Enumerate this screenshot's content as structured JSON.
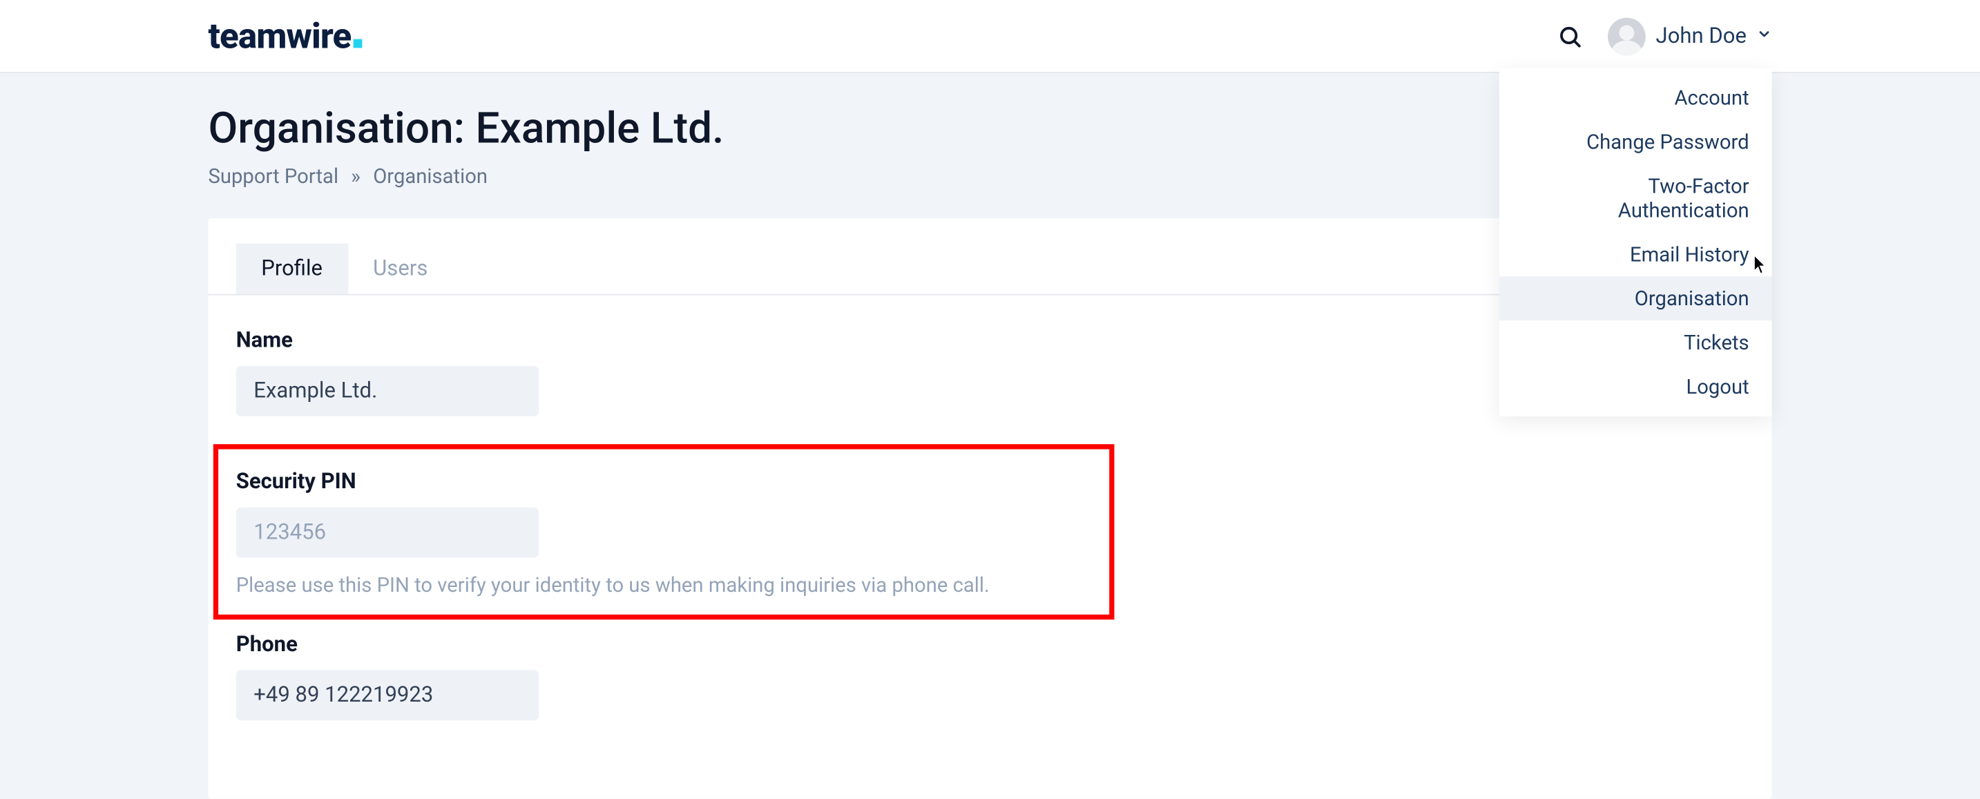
{
  "brand": {
    "name": "teamwire"
  },
  "user": {
    "display_name": "John Doe"
  },
  "dropdown": {
    "items": [
      {
        "label": "Account",
        "highlight": false
      },
      {
        "label": "Change Password",
        "highlight": false
      },
      {
        "label": "Two-Factor Authentication",
        "highlight": false
      },
      {
        "label": "Email History",
        "highlight": false
      },
      {
        "label": "Organisation",
        "highlight": true
      },
      {
        "label": "Tickets",
        "highlight": false
      },
      {
        "label": "Logout",
        "highlight": false
      }
    ]
  },
  "page": {
    "title": "Organisation: Example Ltd.",
    "breadcrumb": {
      "root": "Support Portal",
      "sep": "»",
      "current": "Organisation"
    }
  },
  "tabs": [
    {
      "label": "Profile",
      "active": true
    },
    {
      "label": "Users",
      "active": false
    }
  ],
  "profile": {
    "name": {
      "label": "Name",
      "value": "Example Ltd."
    },
    "pin": {
      "label": "Security PIN",
      "placeholder": "123456",
      "help": "Please use this PIN to verify your identity to us when making inquiries via phone call."
    },
    "phone": {
      "label": "Phone",
      "value": "+49 89 122219923"
    }
  }
}
